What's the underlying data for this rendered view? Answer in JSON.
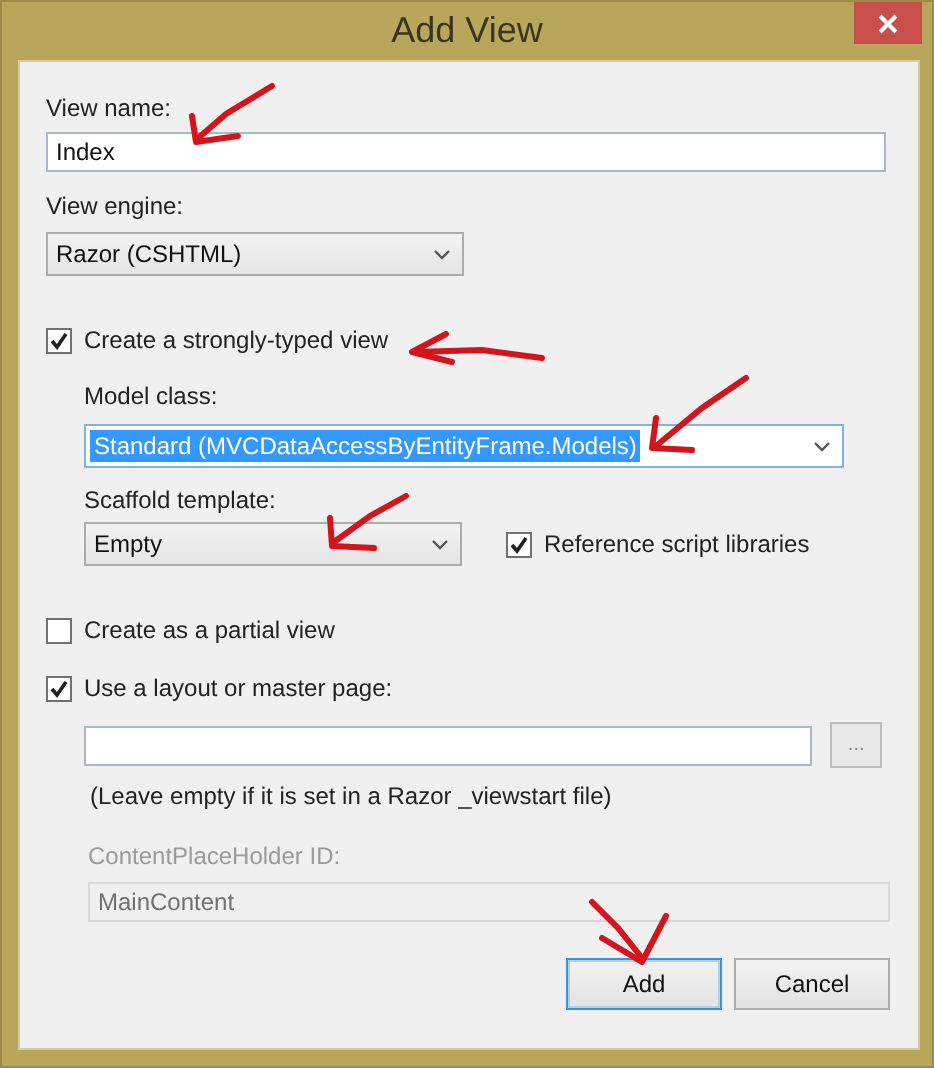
{
  "window": {
    "title": "Add View"
  },
  "view_name": {
    "label": "View name:",
    "value": "Index"
  },
  "view_engine": {
    "label": "View engine:",
    "value": "Razor (CSHTML)"
  },
  "strongly_typed": {
    "label": "Create a strongly-typed view",
    "checked": true
  },
  "model_class": {
    "label": "Model class:",
    "value": "Standard (MVCDataAccessByEntityFrame.Models)",
    "highlighted": true
  },
  "scaffold_template": {
    "label": "Scaffold template:",
    "value": "Empty"
  },
  "reference_scripts": {
    "label": "Reference script libraries",
    "checked": true
  },
  "partial_view": {
    "label": "Create as a partial view",
    "checked": false
  },
  "use_layout": {
    "label": "Use a layout or master page:",
    "checked": true
  },
  "layout_path": {
    "browse": "..."
  },
  "layout_hint": "(Leave empty if it is set in a Razor _viewstart file)",
  "content_placeholder": {
    "label": "ContentPlaceHolder ID:",
    "value": "MainContent",
    "disabled": true
  },
  "buttons": [
    {
      "label": "Add",
      "default": true
    },
    {
      "label": "Cancel",
      "default": false
    }
  ]
}
